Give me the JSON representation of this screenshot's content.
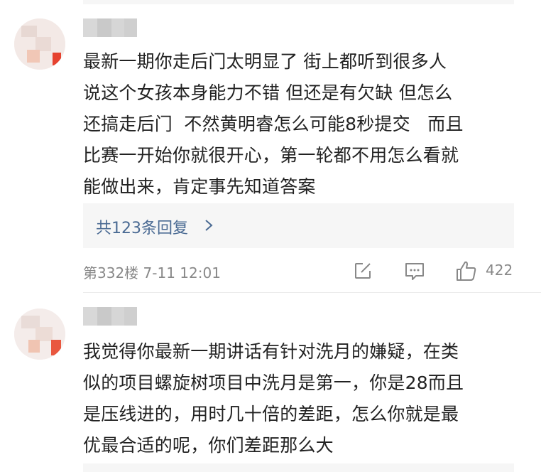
{
  "comments": [
    {
      "text": "最新一期你走后门太明显了 街上都听到很多人\n说这个女孩本身能力不错 但还是有欠缺 但怎么\n还搞走后门  不然黄明睿怎么可能8秒提交   而且\n比赛一开始你就很开心，第一轮都不用怎么看就\n能做出来，肯定事先知道答案",
      "replies_label": "共123条回复",
      "floor_time": "第332楼 7-11 12:01",
      "like_count": "422"
    },
    {
      "text": "我觉得你最新一期讲话有针对洗月的嫌疑，在类\n似的项目螺旋树项目中洗月是第一，你是28而且\n是压线进的，用时几十倍的差距，怎么你就是最\n优最合适的呢，你们差距那么大"
    }
  ],
  "colors": {
    "link": "#4a6a93",
    "meta": "#888888",
    "panel": "#f6f6f6"
  },
  "icons": [
    "share-icon",
    "comment-icon",
    "like-icon",
    "chevron-right-icon"
  ]
}
